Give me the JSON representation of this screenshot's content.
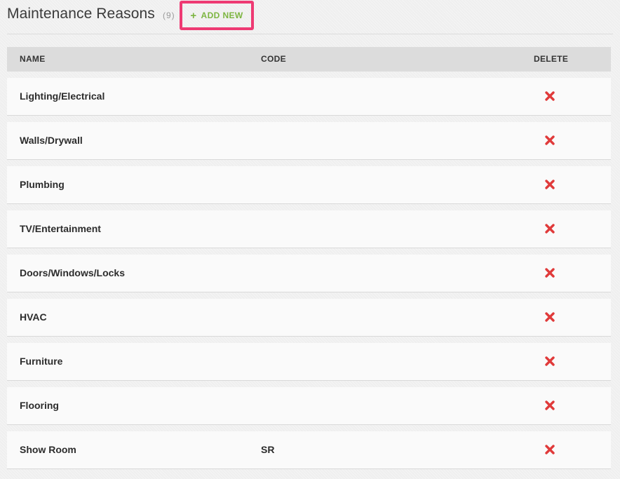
{
  "header": {
    "title": "Maintenance Reasons",
    "count": "(9)",
    "add_new_label": "ADD NEW",
    "add_new_icon": "plus-icon",
    "accent_color": "#7cb540",
    "highlight_color": "#ee3a73"
  },
  "table": {
    "columns": {
      "name": "NAME",
      "code": "CODE",
      "delete": "DELETE"
    },
    "delete_icon": "close-icon",
    "delete_color": "#e03a3a",
    "rows": [
      {
        "name": "Lighting/Electrical",
        "code": ""
      },
      {
        "name": "Walls/Drywall",
        "code": ""
      },
      {
        "name": "Plumbing",
        "code": ""
      },
      {
        "name": "TV/Entertainment",
        "code": ""
      },
      {
        "name": "Doors/Windows/Locks",
        "code": ""
      },
      {
        "name": "HVAC",
        "code": ""
      },
      {
        "name": "Furniture",
        "code": ""
      },
      {
        "name": "Flooring",
        "code": ""
      },
      {
        "name": "Show Room",
        "code": "SR"
      }
    ]
  }
}
